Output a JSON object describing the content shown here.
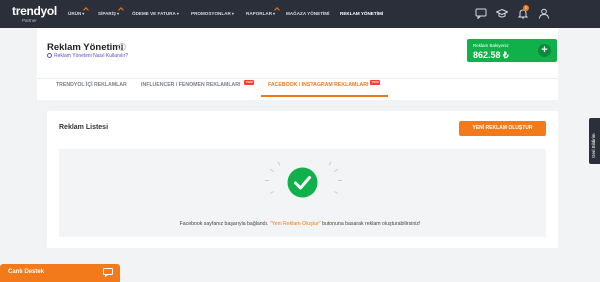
{
  "brand": {
    "name": "trendyol",
    "sub": "Partner",
    "badge": ""
  },
  "nav": [
    {
      "label": "ÜRÜN",
      "has_caret": true,
      "marked": true
    },
    {
      "label": "SİPARİŞ",
      "has_caret": true,
      "marked": true
    },
    {
      "label": "ÖDEME VE FATURA",
      "has_caret": true,
      "marked": false
    },
    {
      "label": "PROMOSYONLAR",
      "has_caret": true,
      "marked": false
    },
    {
      "label": "RAPORLAR",
      "has_caret": true,
      "marked": true
    },
    {
      "label": "MAĞAZA YÖNETİMİ",
      "has_caret": false,
      "marked": false
    },
    {
      "label": "REKLAM YÖNETİMİ",
      "has_caret": false,
      "marked": false
    }
  ],
  "caret": "▾",
  "notifications_count": "0",
  "page": {
    "title": "Reklam Yönetimi",
    "info_glyph": "?",
    "help_link": "Reklam Yönetimi Nasıl Kullanılır?"
  },
  "balance": {
    "label": "Reklam Bakiyeniz",
    "amount": "862.58 ₺",
    "add": "+"
  },
  "tabs": [
    {
      "label": "TRENDYOL İÇİ REKLAMLAR",
      "active": false,
      "badge": ""
    },
    {
      "label": "INFLUENCER / FENOMEN REKLAMLARI",
      "active": false,
      "badge": "YENİ"
    },
    {
      "label": "FACEBOOK / INSTAGRAM REKLAMLARI",
      "active": true,
      "badge": "YENİ"
    }
  ],
  "list": {
    "title": "Reklam Listesi",
    "create_button": "YENİ REKLAM OLUŞTUR",
    "message_before": "Facebook sayfanız başarıyla bağlandı. ",
    "message_highlight": "\"Yeni Reklam Oluştur\"",
    "message_after": " butonuna basarak reklam oluşturabilirsiniz!"
  },
  "chat": {
    "label": "Canlı Destek"
  },
  "side_tab": {
    "label": "Geri Bildirim"
  },
  "colors": {
    "topbar": "#2b2f3a",
    "accent": "#f27a1a",
    "success": "#10b14b",
    "badge": "#ff3b2f"
  }
}
